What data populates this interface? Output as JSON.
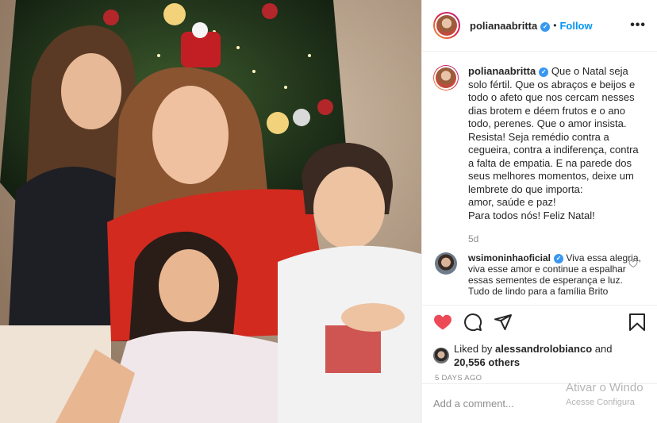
{
  "post": {
    "username": "polianaabritta",
    "verified_mark": "✓",
    "dot": "•",
    "follow_label": "Follow",
    "more_label": "•••",
    "caption_user": "polianaabritta",
    "caption": "Que o Natal seja solo fértil. Que os abraços e beijos e todo o afeto que nos cercam nesses dias brotem e déem frutos e o ano todo, perenes. Que o amor insista. Resista! Seja remédio contra a cegueira, contra a indiferença, contra a falta de empatia. E na parede dos seus melhores momentos, deixe um lembrete do que importa:",
    "caption_line2": "amor, saúde e paz!",
    "caption_line3": "Para todos nós! Feliz Natal!",
    "caption_time": "5d"
  },
  "comment": {
    "user": "wsimoninhaoficial",
    "text": "Viva essa alegria, viva esse amor e continue a espalhar essas sementes de esperança e luz. Tudo de lindo para a família Brito"
  },
  "likes": {
    "prefix": "Liked by",
    "user": "alessandrolobianco",
    "mid": "and",
    "count": "20,556 others"
  },
  "time_ago": "5 DAYS AGO",
  "add_comment_placeholder": "Add a comment...",
  "watermark": {
    "line1": "Ativar o Windo",
    "line2": "Acesse Configura"
  },
  "icons": [
    "heart-icon",
    "comment-icon",
    "share-icon",
    "bookmark-icon",
    "heart-small-icon",
    "more-icon"
  ],
  "colors": {
    "accent": "#0095f6",
    "liked": "#ed4956",
    "verified": "#3897f0"
  }
}
